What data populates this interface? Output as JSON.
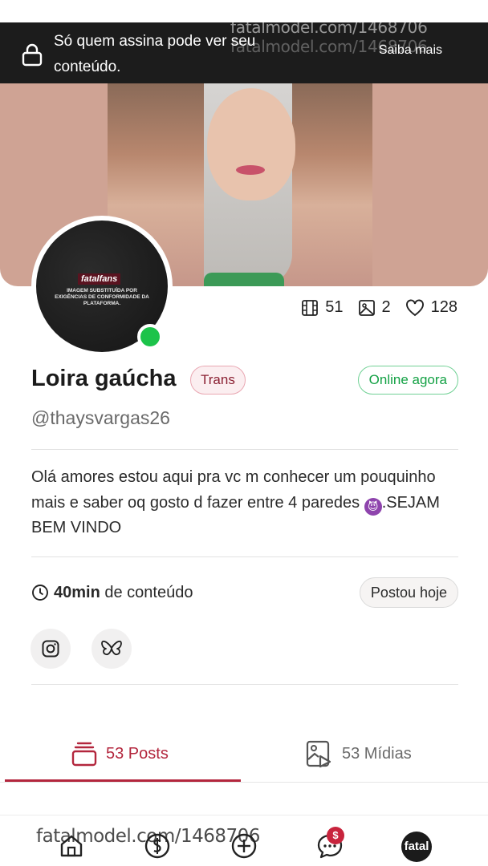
{
  "banner": {
    "message": "Só quem assina pode ver seu conteúdo.",
    "link": "Saiba mais",
    "watermark": "fatalmodel.com/1468706"
  },
  "avatar": {
    "brand": "fatalfans",
    "notice": "IMAGEM SUBSTITUÍDA POR EXIGÊNCIAS DE CONFORMIDADE DA PLATAFORMA."
  },
  "stats": {
    "videos": "51",
    "photos": "2",
    "likes": "128"
  },
  "profile": {
    "name": "Loira gaúcha",
    "tag": "Trans",
    "status": "Online agora",
    "handle": "@thaysvargas26",
    "bio_before_emoji": "Olá amores estou aqui pra vc m conhecer um pouquinho mais e saber oq gosto d fazer entre 4 paredes ",
    "bio_emoji": "😈",
    "bio_after_emoji": ".SEJAM BEM VINDO"
  },
  "content": {
    "duration": "40min",
    "duration_suffix": "de conteúdo",
    "posted": "Postou hoje"
  },
  "social": {
    "instagram_icon": "instagram-icon",
    "bluesky_icon": "butterfly-icon"
  },
  "tabs": {
    "posts": "53 Posts",
    "media": "53 Mídias"
  },
  "bottom_nav": {
    "badge": "$",
    "profile": "fatal",
    "watermark": "fatalmodel.com/1468706"
  },
  "colors": {
    "accent": "#b3263d",
    "online": "#1cc34a",
    "banner_bg": "#1c1c1c"
  }
}
